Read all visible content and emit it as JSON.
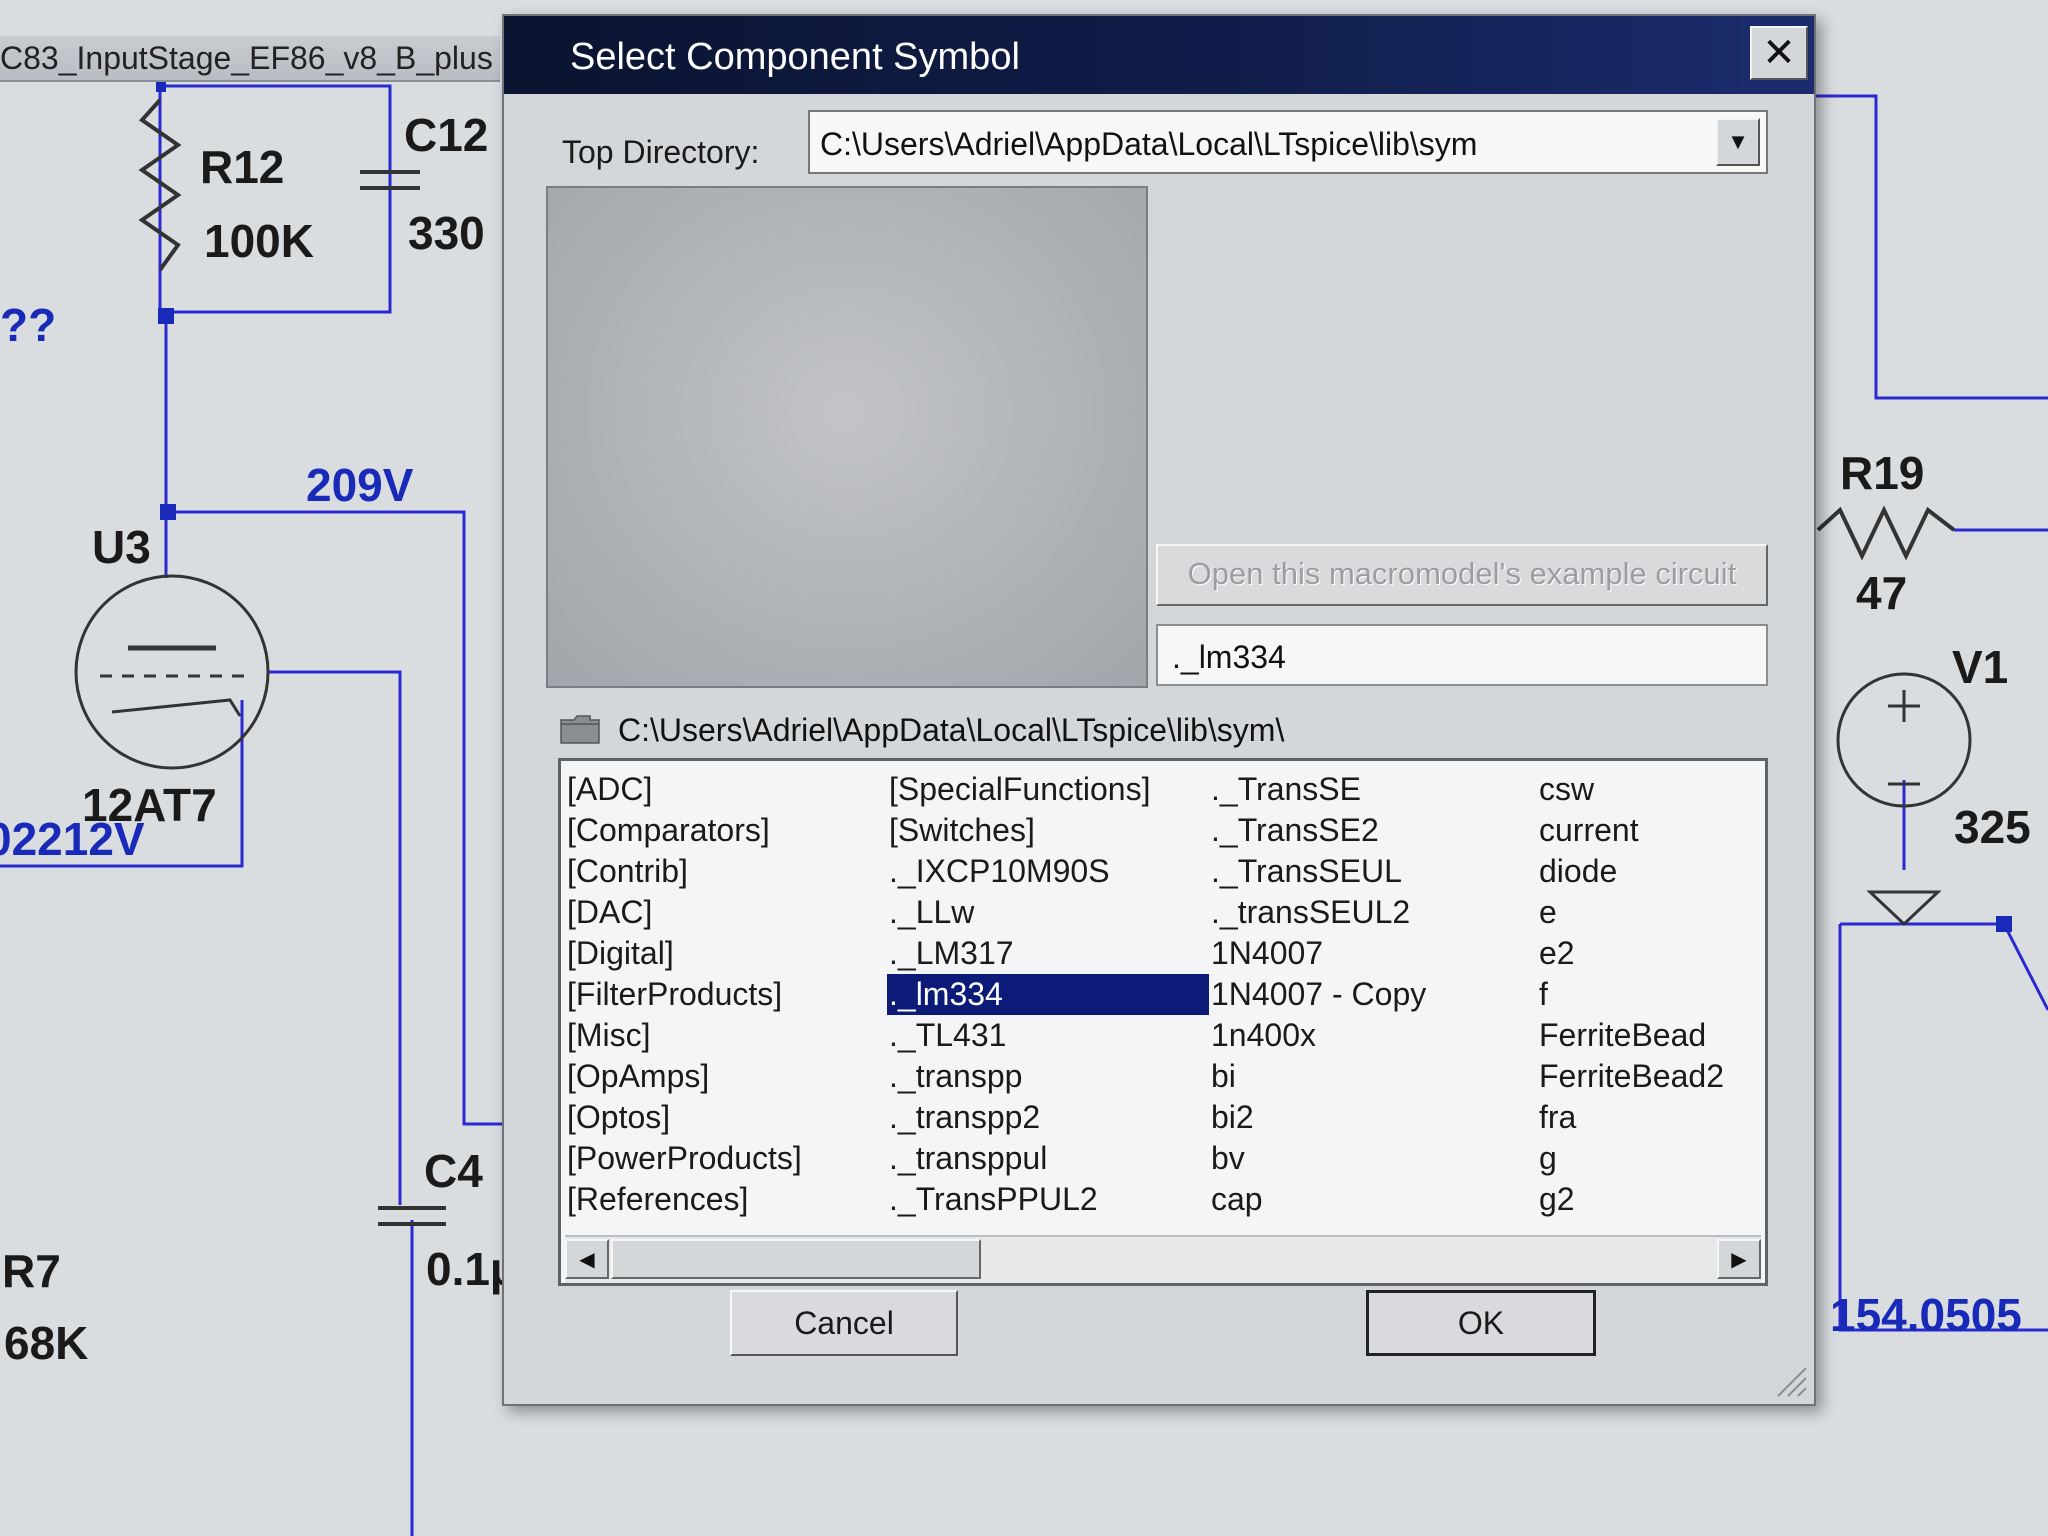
{
  "background": {
    "window_title": "C83_InputStage_EF86_v8_B_plus",
    "labels": {
      "r12": "R12",
      "r12_value": "100K",
      "c12": "C12",
      "c12_value": "330",
      "u3": "U3",
      "u3_type": "12AT7",
      "c4": "C4",
      "c4_value": "0.1µ",
      "r7": "R7",
      "r7_value": "68K",
      "r19": "R19",
      "r19_value": "47",
      "v1": "V1",
      "v1_value": "325"
    },
    "voltages": {
      "v209": "209V",
      "v_left": "02212V",
      "v_unknown": "??",
      "v_right": "154.0505"
    },
    "wire_color": "#2a2ad0",
    "node_color": "#1a2ab8"
  },
  "dialog": {
    "title": "Select Component Symbol",
    "close_glyph": "✕",
    "top_directory_label": "Top Directory:",
    "top_directory_value": "C:\\Users\\Adriel\\AppData\\Local\\LTspice\\lib\\sym",
    "example_button": "Open this macromodel's example circuit",
    "symbol_name": "._lm334",
    "current_path": "C:\\Users\\Adriel\\AppData\\Local\\LTspice\\lib\\sym\\",
    "columns": [
      [
        "[ADC]",
        "[Comparators]",
        "[Contrib]",
        "[DAC]",
        "[Digital]",
        "[FilterProducts]",
        "[Misc]",
        "[OpAmps]",
        "[Optos]",
        "[PowerProducts]",
        "[References]"
      ],
      [
        "[SpecialFunctions]",
        "[Switches]",
        "._IXCP10M90S",
        "._LLw",
        "._LM317",
        "._lm334",
        "._TL431",
        "._transpp",
        "._transpp2",
        "._transppul",
        "._TransPPUL2"
      ],
      [
        "._TransSE",
        "._TransSE2",
        "._TransSEUL",
        "._transSEUL2",
        "1N4007",
        "1N4007 - Copy",
        "1n400x",
        "bi",
        "bi2",
        "bv",
        "cap"
      ],
      [
        "csw",
        "current",
        "diode",
        "e",
        "e2",
        "f",
        "FerriteBead",
        "FerriteBead2",
        "fra",
        "g",
        "g2"
      ]
    ],
    "selected_item": "._lm334",
    "cancel_label": "Cancel",
    "ok_label": "OK",
    "selection_color": "#0c1a78"
  }
}
